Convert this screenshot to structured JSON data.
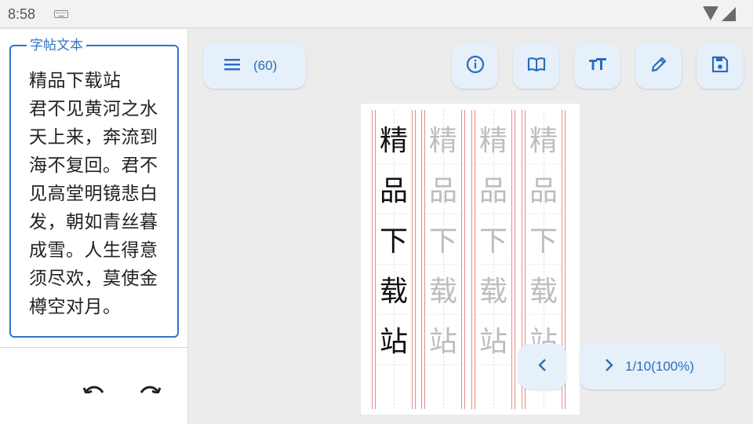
{
  "status_bar": {
    "time": "8:58"
  },
  "left_panel": {
    "text_box_label": "字帖文本",
    "text_content": "精品下载站\n君不见黄河之水天上来，奔流到海不复回。君不见高堂明镜悲白发，朝如青丝暮成雪。人生得意须尽欢，莫使金樽空对月。"
  },
  "toolbar": {
    "menu_count": "(60)",
    "buttons": [
      "info-icon",
      "book-icon",
      "font-size-icon",
      "edit-icon",
      "save-icon"
    ]
  },
  "sheet": {
    "characters": [
      "精",
      "品",
      "下",
      "载",
      "站"
    ],
    "trace_columns": 3
  },
  "pagination": {
    "page_label": "1/10(100%)"
  },
  "colors": {
    "accent": "#2f76c7",
    "button_bg": "#e6f0fb",
    "grid_line": "#e88b8b",
    "trace_text": "#bdbdbd"
  }
}
